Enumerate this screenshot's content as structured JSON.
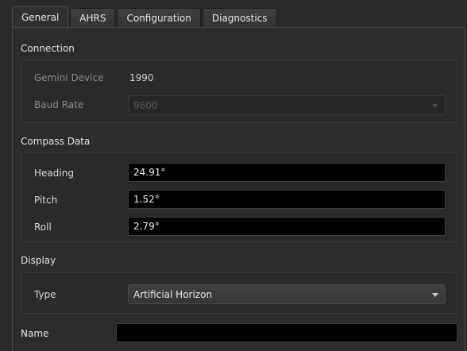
{
  "tabs": [
    {
      "label": "General",
      "active": true
    },
    {
      "label": "AHRS",
      "active": false
    },
    {
      "label": "Configuration",
      "active": false
    },
    {
      "label": "Diagnostics",
      "active": false
    }
  ],
  "connection": {
    "title": "Connection",
    "device_label": "Gemini Device",
    "device_value": "1990",
    "baud_label": "Baud Rate",
    "baud_value": "9600"
  },
  "compass": {
    "title": "Compass Data",
    "heading_label": "Heading",
    "heading_value": "24.91°",
    "pitch_label": "Pitch",
    "pitch_value": "1.52°",
    "roll_label": "Roll",
    "roll_value": "2.79°"
  },
  "display": {
    "title": "Display",
    "type_label": "Type",
    "type_value": "Artificial Horizon"
  },
  "name": {
    "label": "Name",
    "value": ""
  }
}
